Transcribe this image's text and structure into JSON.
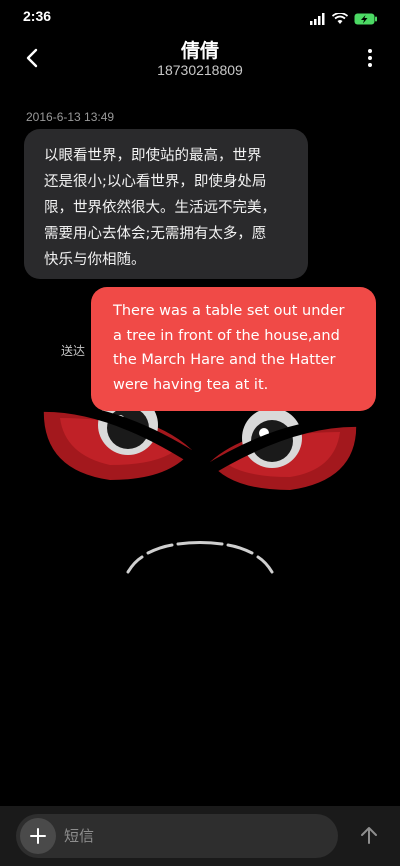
{
  "status_bar": {
    "time": "2:36",
    "icons": [
      "signal-icon",
      "wifi-icon",
      "battery-charging-icon"
    ],
    "battery_color": "#4cd964"
  },
  "header": {
    "contact_name": "倩倩",
    "contact_number": "18730218809",
    "back_icon": "chevron-left-icon",
    "more_icon": "more-vertical-icon"
  },
  "conversation": {
    "timestamp": "2016-6-13 13:49",
    "messages": [
      {
        "direction": "incoming",
        "lines": [
          "以眼看世界，即使站的最高，世界",
          "还是很小;以心看世界，即使身处局",
          "限，世界依然很大。生活远不完美，",
          "需要用心去体会;无需拥有太多，愿",
          "快乐与你相随。"
        ]
      },
      {
        "direction": "outgoing",
        "lines": [
          "There was a table set out under",
          "a tree in front of the house,and",
          "the March Hare and the Hatter",
          "were having tea at it."
        ],
        "status": "送达"
      }
    ]
  },
  "input": {
    "placeholder": "短信",
    "add_icon": "plus-icon",
    "send_icon": "arrow-up-icon"
  },
  "colors": {
    "outgoing_bubble": "#f04a47",
    "incoming_bubble": "#2a2a2c",
    "background": "#000000"
  }
}
